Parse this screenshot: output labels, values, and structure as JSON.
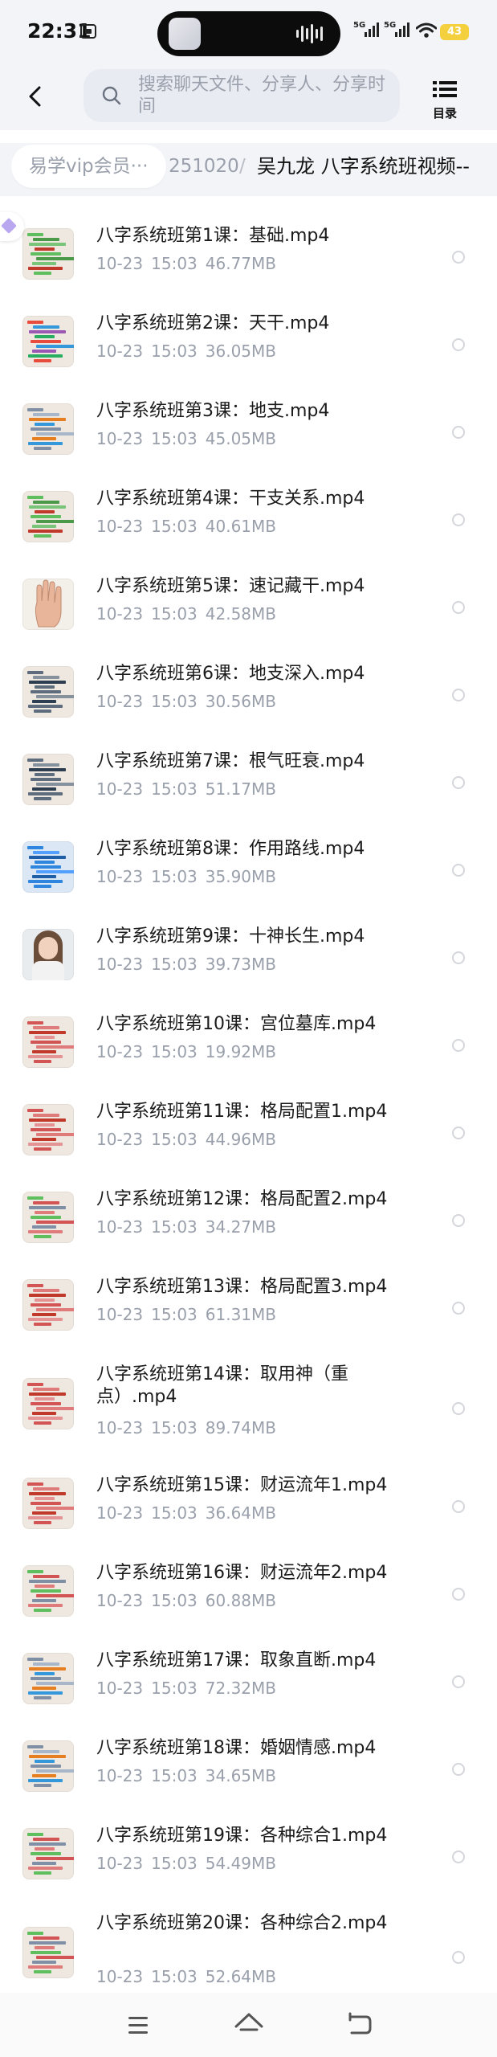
{
  "status_bar": {
    "time": "22:31",
    "signal1_label": "5G",
    "signal2_label": "5G",
    "battery": "43"
  },
  "header": {
    "search_placeholder": "搜索聊天文件、分享人、分享时间",
    "toc_label": "目录"
  },
  "breadcrumb": {
    "root": "易学vip会员···",
    "middle": "251020",
    "separator": "/",
    "current": "吴九龙 八字系统班视频--"
  },
  "files": [
    {
      "name": "八字系统班第1课：基础.mp4",
      "date": "10-23",
      "time": "15:03",
      "size": "46.77MB",
      "thumb": "green"
    },
    {
      "name": "八字系统班第2课：天干.mp4",
      "date": "10-23",
      "time": "15:03",
      "size": "36.05MB",
      "thumb": "color"
    },
    {
      "name": "八字系统班第3课：地支.mp4",
      "date": "10-23",
      "time": "15:03",
      "size": "45.05MB",
      "thumb": "grid"
    },
    {
      "name": "八字系统班第4课：干支关系.mp4",
      "date": "10-23",
      "time": "15:03",
      "size": "40.61MB",
      "thumb": "green"
    },
    {
      "name": "八字系统班第5课：速记藏干.mp4",
      "date": "10-23",
      "time": "15:03",
      "size": "42.58MB",
      "thumb": "hand"
    },
    {
      "name": "八字系统班第6课：地支深入.mp4",
      "date": "10-23",
      "time": "15:03",
      "size": "30.56MB",
      "thumb": "text"
    },
    {
      "name": "八字系统班第7课：根气旺衰.mp4",
      "date": "10-23",
      "time": "15:03",
      "size": "51.17MB",
      "thumb": "text"
    },
    {
      "name": "八字系统班第8课：作用路线.mp4",
      "date": "10-23",
      "time": "15:03",
      "size": "35.90MB",
      "thumb": "blue"
    },
    {
      "name": "八字系统班第9课：十神长生.mp4",
      "date": "10-23",
      "time": "15:03",
      "size": "39.73MB",
      "thumb": "photo"
    },
    {
      "name": "八字系统班第10课：宫位墓库.mp4",
      "date": "10-23",
      "time": "15:03",
      "size": "19.92MB",
      "thumb": "red"
    },
    {
      "name": "八字系统班第11课：格局配置1.mp4",
      "date": "10-23",
      "time": "15:03",
      "size": "44.96MB",
      "thumb": "red"
    },
    {
      "name": "八字系统班第12课：格局配置2.mp4",
      "date": "10-23",
      "time": "15:03",
      "size": "34.27MB",
      "thumb": "mixed"
    },
    {
      "name": "八字系统班第13课：格局配置3.mp4",
      "date": "10-23",
      "time": "15:03",
      "size": "61.31MB",
      "thumb": "red"
    },
    {
      "name": "八字系统班第14课：取用神（重点）.mp4",
      "date": "10-23",
      "time": "15:03",
      "size": "89.74MB",
      "thumb": "red"
    },
    {
      "name": "八字系统班第15课：财运流年1.mp4",
      "date": "10-23",
      "time": "15:03",
      "size": "36.64MB",
      "thumb": "red"
    },
    {
      "name": "八字系统班第16课：财运流年2.mp4",
      "date": "10-23",
      "time": "15:03",
      "size": "60.88MB",
      "thumb": "mixed"
    },
    {
      "name": "八字系统班第17课：取象直断.mp4",
      "date": "10-23",
      "time": "15:03",
      "size": "72.32MB",
      "thumb": "grid"
    },
    {
      "name": "八字系统班第18课：婚姻情感.mp4",
      "date": "10-23",
      "time": "15:03",
      "size": "34.65MB",
      "thumb": "grid"
    },
    {
      "name": "八字系统班第19课：各种综合1.mp4",
      "date": "10-23",
      "time": "15:03",
      "size": "54.49MB",
      "thumb": "mixed"
    },
    {
      "name": "八字系统班第20课：各种综合2.mp4",
      "date": "10-23",
      "time": "15:03",
      "size": "52.64MB",
      "thumb": "mixed"
    }
  ]
}
